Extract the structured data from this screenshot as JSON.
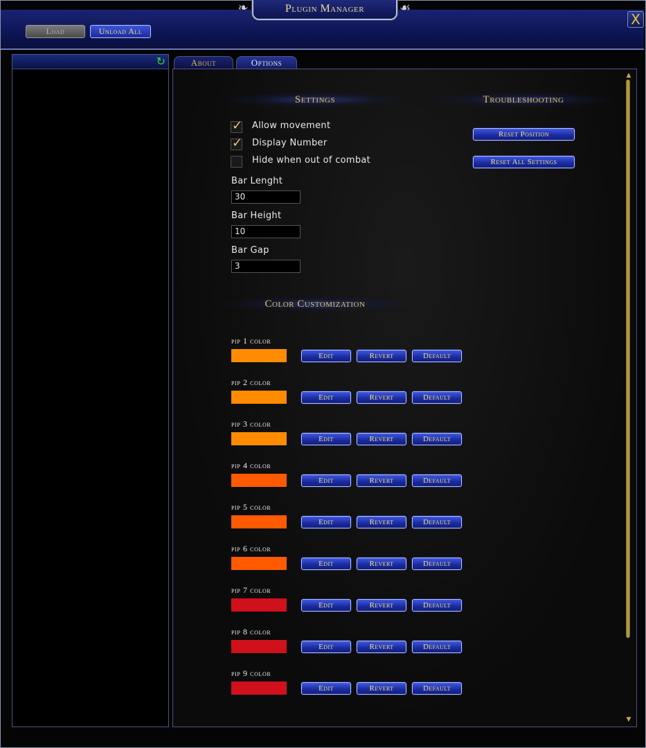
{
  "window": {
    "title": "Plugin Manager",
    "close_label": "X"
  },
  "toolbar": {
    "load_label": "Load",
    "unload_all_label": "Unload All"
  },
  "tabs": [
    {
      "label": "About",
      "active": false
    },
    {
      "label": "Options",
      "active": true
    }
  ],
  "settings": {
    "title": "Settings",
    "checkboxes": [
      {
        "label": "Allow movement",
        "checked": true
      },
      {
        "label": "Display Number",
        "checked": true
      },
      {
        "label": "Hide when out of combat",
        "checked": false
      }
    ],
    "fields": [
      {
        "label": "Bar Lenght",
        "value": "30"
      },
      {
        "label": "Bar Height",
        "value": "10"
      },
      {
        "label": "Bar Gap",
        "value": "3"
      }
    ]
  },
  "troubleshooting": {
    "title": "Troubleshooting",
    "reset_position_label": "Reset Position",
    "reset_all_label": "Reset All Settings"
  },
  "color_customization": {
    "title": "Color Customization",
    "edit_label": "Edit",
    "revert_label": "Revert",
    "default_label": "Default",
    "pips": [
      {
        "label": "pip 1 color",
        "color": "#ff8c00"
      },
      {
        "label": "pip 2 color",
        "color": "#ff8c00"
      },
      {
        "label": "pip 3 color",
        "color": "#ff8c00"
      },
      {
        "label": "pip 4 color",
        "color": "#ff5a00"
      },
      {
        "label": "pip 5 color",
        "color": "#ff5a00"
      },
      {
        "label": "pip 6 color",
        "color": "#ff5a00"
      },
      {
        "label": "pip 7 color",
        "color": "#d0101a"
      },
      {
        "label": "pip 8 color",
        "color": "#d0101a"
      },
      {
        "label": "pip 9 color",
        "color": "#d0101a"
      }
    ]
  }
}
